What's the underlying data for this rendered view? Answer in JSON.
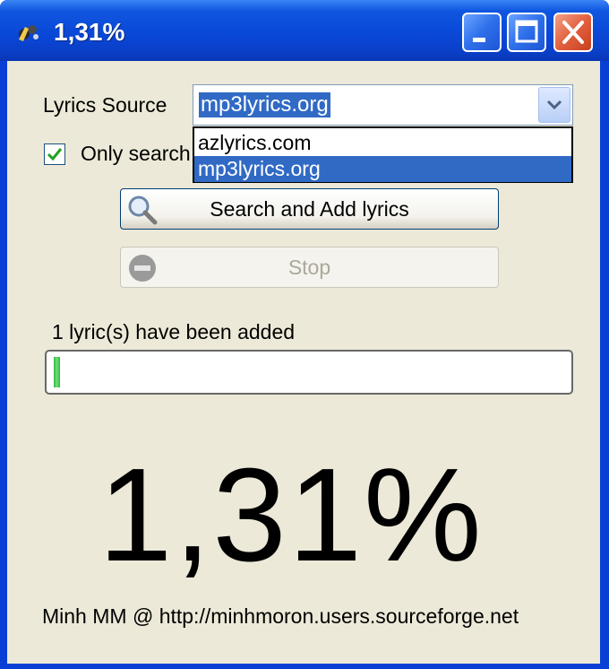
{
  "window": {
    "title": "1,31%"
  },
  "title_buttons": {
    "minimize": "minimize-icon",
    "maximize": "maximize-icon",
    "close": "close-icon"
  },
  "form": {
    "lyrics_source_label": "Lyrics Source",
    "source_selected": "mp3lyrics.org",
    "source_options": [
      "azlyrics.com",
      "mp3lyrics.org"
    ],
    "only_search_label": "Only search",
    "only_search_checked": true,
    "search_button_label": "Search and Add lyrics",
    "stop_button_label": "Stop",
    "status_text": "1 lyric(s) have been added",
    "progress_value": 0.0131,
    "big_percent": "1,31%",
    "footer": "Minh MM @ http://minhmoron.users.sourceforge.net"
  },
  "colors": {
    "titlebar": "#0a48d8",
    "client_bg": "#ece9d8",
    "selection": "#316ac5",
    "progress": "#2db54a"
  }
}
